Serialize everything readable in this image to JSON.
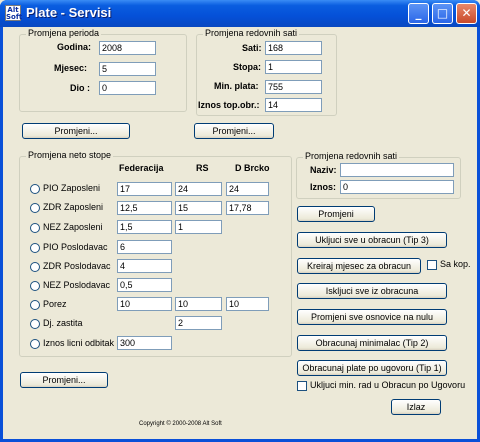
{
  "window": {
    "title": "Plate - Servisi",
    "icon_label": "Alt Soft",
    "minimize": "_",
    "maximize": "□",
    "close": "✕"
  },
  "period": {
    "title": "Promjena perioda",
    "godina_label": "Godina:",
    "godina_value": "2008",
    "mjesec_label": "Mjesec:",
    "mjesec_value": "5",
    "dio_label": "Dio :",
    "dio_value": "0",
    "button": "Promjeni..."
  },
  "hours": {
    "title": "Promjena redovnih sati",
    "sati_label": "Sati:",
    "sati_value": "168",
    "stopa_label": "Stopa:",
    "stopa_value": "1",
    "min_label": "Min. plata:",
    "min_value": "755",
    "iznos_label": "Iznos top.obr.:",
    "iznos_value": "14",
    "button": "Promjeni..."
  },
  "neto": {
    "title": "Promjena neto stope",
    "col_fed": "Federacija",
    "col_rs": "RS",
    "col_db": "D Brcko",
    "rows": [
      {
        "label": "PIO Zaposleni",
        "fed": "17",
        "rs": "24",
        "db": "24"
      },
      {
        "label": "ZDR Zaposleni",
        "fed": "12,5",
        "rs": "15",
        "db": "17,78"
      },
      {
        "label": "NEZ Zaposleni",
        "fed": "1,5",
        "rs": "1"
      },
      {
        "label": "PIO Poslodavac",
        "fed": "6"
      },
      {
        "label": "ZDR Poslodavac",
        "fed": "4"
      },
      {
        "label": "NEZ Poslodavac",
        "fed": "0,5"
      },
      {
        "label": "Porez",
        "fed": "10",
        "rs": "10",
        "db": "10"
      },
      {
        "label": "Dj. zastita",
        "rs": "2"
      },
      {
        "label": "Iznos licni odbitak",
        "fed": "300"
      }
    ],
    "button": "Promjeni..."
  },
  "hours2": {
    "title": "Promjena redovnih sati",
    "naziv_label": "Naziv:",
    "naziv_value": "",
    "iznos_label": "Iznos:",
    "iznos_value": "0"
  },
  "actions": {
    "promjeni": "Promjeni",
    "ukljuci": "Ukljuci sve u obracun (Tip 3)",
    "kreiraj": "Kreiraj mjesec za obracun",
    "sa_kop": "Sa kop.",
    "iskljuci": "Iskljuci sve iz obracuna",
    "nulu": "Promjeni sve osnovice na nulu",
    "minimalac": "Obracunaj minimalac (Tip 2)",
    "ugovoru": "Obracunaj plate po ugovoru (Tip 1)",
    "min_rad": "Ukljuci min. rad u Obracun po Ugovoru",
    "izlaz": "Izlaz"
  },
  "footer": {
    "copyright": "Copyright © 2000-2008 Alt Soft"
  }
}
